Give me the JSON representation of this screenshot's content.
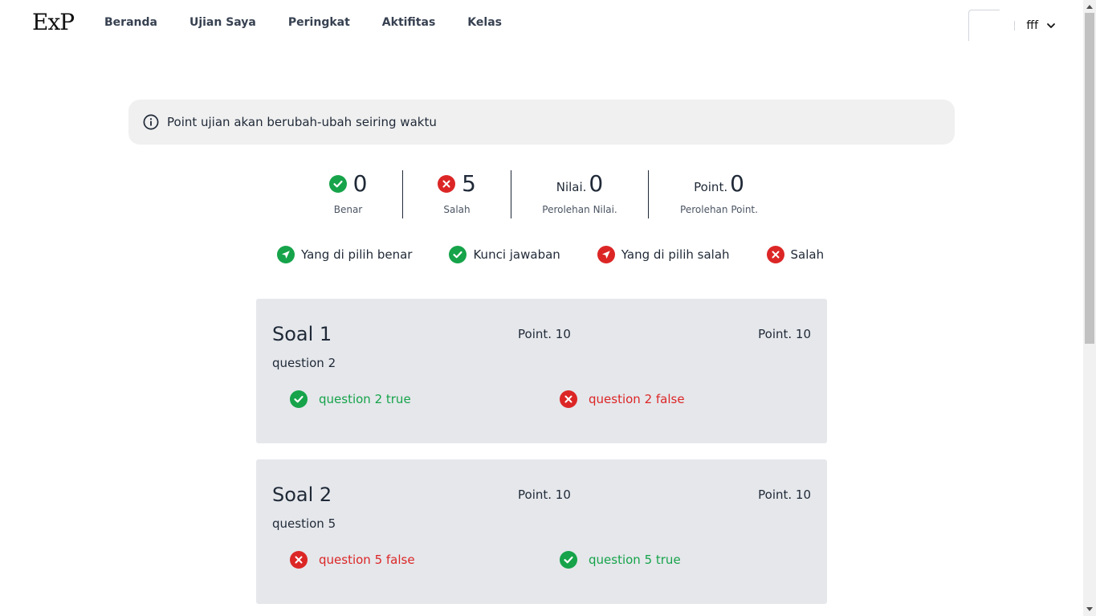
{
  "app": {
    "logo": "ExP"
  },
  "nav": {
    "items": [
      "Beranda",
      "Ujian Saya",
      "Peringkat",
      "Aktifitas",
      "Kelas"
    ]
  },
  "user": {
    "name": "fff"
  },
  "alert": {
    "text": "Point ujian akan berubah-ubah seiring waktu"
  },
  "stats": {
    "correct": {
      "value": "0",
      "label": "Benar"
    },
    "wrong": {
      "value": "5",
      "label": "Salah"
    },
    "score": {
      "prefix": "Nilai.",
      "value": "0",
      "label": "Perolehan Nilai."
    },
    "points": {
      "prefix": "Point.",
      "value": "0",
      "label": "Perolehan Point."
    }
  },
  "legend": {
    "chosen_correct": "Yang di pilih benar",
    "answer_key": "Kunci jawaban",
    "chosen_wrong": "Yang di pilih salah",
    "wrong": "Salah"
  },
  "questions": [
    {
      "title": "Soal 1",
      "point_mid": "Point. 10",
      "point_right": "Point. 10",
      "question": "question 2",
      "options": [
        {
          "text": "question 2 true",
          "status": "correct"
        },
        {
          "text": "question 2 false",
          "status": "wrong"
        }
      ]
    },
    {
      "title": "Soal 2",
      "point_mid": "Point. 10",
      "point_right": "Point. 10",
      "question": "question 5",
      "options": [
        {
          "text": "question 5 false",
          "status": "wrong"
        },
        {
          "text": "question 5 true",
          "status": "correct"
        }
      ]
    }
  ],
  "colors": {
    "green": "#16a34a",
    "red": "#dc2626",
    "card_bg": "#e5e7eb",
    "alert_bg": "#f0f0f0"
  }
}
